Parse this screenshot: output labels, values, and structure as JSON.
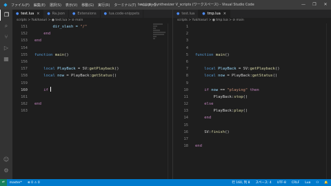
{
  "titlebar": {
    "menu": [
      "ファイル(F)",
      "編集(E)",
      "選択(S)",
      "表示(V)",
      "移動(G)",
      "実行(R)",
      "ターミナル(T)",
      "ヘルプ(H)"
    ],
    "title": "test.lua - Synthesizer V_scripts (ワークスペース) - Visual Studio Code",
    "controls": [
      "—",
      "❐",
      "✕"
    ]
  },
  "left_editor": {
    "tabs": [
      {
        "label": "test.lua",
        "active": true
      },
      {
        "label": "Ra.json",
        "active": false
      },
      {
        "label": "Extensions",
        "active": false
      },
      {
        "label": "lua.code-snippets",
        "active": false
      }
    ],
    "breadcrumb": "scripts > Yukihasuri > ● test.lua > ⊘ main",
    "lines": [
      {
        "n": "151",
        "tokens": [
          {
            "t": "        dir_slash = ",
            "c": "var"
          },
          {
            "t": "\"/\"",
            "c": "str"
          }
        ]
      },
      {
        "n": "152",
        "tokens": [
          {
            "t": "    end",
            "c": "kw2"
          }
        ]
      },
      {
        "n": "153",
        "tokens": [
          {
            "t": "end",
            "c": "kw2"
          }
        ]
      },
      {
        "n": "154",
        "tokens": []
      },
      {
        "n": "155",
        "tokens": [
          {
            "t": "function ",
            "c": "kw"
          },
          {
            "t": "main",
            "c": "fn"
          },
          {
            "t": "()",
            "c": "txt"
          }
        ]
      },
      {
        "n": "156",
        "tokens": []
      },
      {
        "n": "157",
        "tokens": [
          {
            "t": "    local ",
            "c": "kw"
          },
          {
            "t": "PlayBack",
            "c": "var"
          },
          {
            "t": " = SV:",
            "c": "txt"
          },
          {
            "t": "getPlayback",
            "c": "fn"
          },
          {
            "t": "()",
            "c": "txt"
          }
        ]
      },
      {
        "n": "158",
        "tokens": [
          {
            "t": "    local ",
            "c": "kw"
          },
          {
            "t": "now",
            "c": "var"
          },
          {
            "t": " = PlayBack:",
            "c": "txt"
          },
          {
            "t": "getStatus",
            "c": "fn"
          },
          {
            "t": "()",
            "c": "txt"
          }
        ]
      },
      {
        "n": "159",
        "tokens": []
      },
      {
        "n": "160",
        "tokens": [
          {
            "t": "    if ",
            "c": "kw2"
          }
        ],
        "cursor": true
      },
      {
        "n": "161",
        "tokens": []
      },
      {
        "n": "162",
        "tokens": [
          {
            "t": "end",
            "c": "kw2"
          }
        ]
      },
      {
        "n": "163",
        "tokens": []
      }
    ]
  },
  "right_editor": {
    "tabs": [
      {
        "label": "test.lua",
        "active": false
      },
      {
        "label": "tmp.lua",
        "active": true
      }
    ],
    "breadcrumb": "scripts > Yukihasuri > ● tmp.lua > ⊘ main",
    "lines": [
      {
        "n": "1",
        "tokens": []
      },
      {
        "n": "2",
        "tokens": []
      },
      {
        "n": "3",
        "tokens": []
      },
      {
        "n": "4",
        "tokens": []
      },
      {
        "n": "5",
        "tokens": [
          {
            "t": "function ",
            "c": "kw"
          },
          {
            "t": "main",
            "c": "fn"
          },
          {
            "t": "()",
            "c": "txt"
          }
        ]
      },
      {
        "n": "6",
        "tokens": []
      },
      {
        "n": "7",
        "tokens": [
          {
            "t": "    local ",
            "c": "kw"
          },
          {
            "t": "PlayBack",
            "c": "var"
          },
          {
            "t": " = SV:",
            "c": "txt"
          },
          {
            "t": "getPlayback",
            "c": "fn"
          },
          {
            "t": "()",
            "c": "txt"
          }
        ]
      },
      {
        "n": "8",
        "tokens": [
          {
            "t": "    local ",
            "c": "kw"
          },
          {
            "t": "now",
            "c": "var"
          },
          {
            "t": " = PlayBack:",
            "c": "txt"
          },
          {
            "t": "getStatus",
            "c": "fn"
          },
          {
            "t": "()",
            "c": "txt"
          }
        ]
      },
      {
        "n": "9",
        "tokens": []
      },
      {
        "n": "10",
        "tokens": [
          {
            "t": "    if ",
            "c": "kw2"
          },
          {
            "t": "now",
            "c": "var"
          },
          {
            "t": " == ",
            "c": "txt"
          },
          {
            "t": "\"playing\"",
            "c": "str"
          },
          {
            "t": " then",
            "c": "kw2"
          }
        ]
      },
      {
        "n": "11",
        "tokens": [
          {
            "t": "        PlayBack:",
            "c": "txt"
          },
          {
            "t": "stop",
            "c": "fn"
          },
          {
            "t": "()",
            "c": "txt"
          }
        ]
      },
      {
        "n": "12",
        "tokens": [
          {
            "t": "    else",
            "c": "kw2"
          }
        ]
      },
      {
        "n": "13",
        "tokens": [
          {
            "t": "        PlayBack:",
            "c": "txt"
          },
          {
            "t": "play",
            "c": "fn"
          },
          {
            "t": "()",
            "c": "txt"
          }
        ]
      },
      {
        "n": "14",
        "tokens": [
          {
            "t": "    end",
            "c": "kw2"
          }
        ]
      },
      {
        "n": "15",
        "tokens": []
      },
      {
        "n": "16",
        "tokens": [
          {
            "t": "    SV:",
            "c": "txt"
          },
          {
            "t": "finish",
            "c": "fn"
          },
          {
            "t": "()",
            "c": "txt"
          }
        ]
      },
      {
        "n": "17",
        "tokens": []
      },
      {
        "n": "18",
        "tokens": [
          {
            "t": "end",
            "c": "kw2"
          }
        ]
      }
    ]
  },
  "statusbar": {
    "remote": "master*",
    "problems": "⊗ 0 ⚠ 0",
    "right_items": [
      "行 160, 列 8",
      "スペース: 4",
      "UTF-8",
      "CRLF",
      "Lua",
      "⚇",
      "🔔"
    ]
  },
  "colors": {
    "statusbar": "#007acc",
    "accent": "#23a9f2"
  }
}
